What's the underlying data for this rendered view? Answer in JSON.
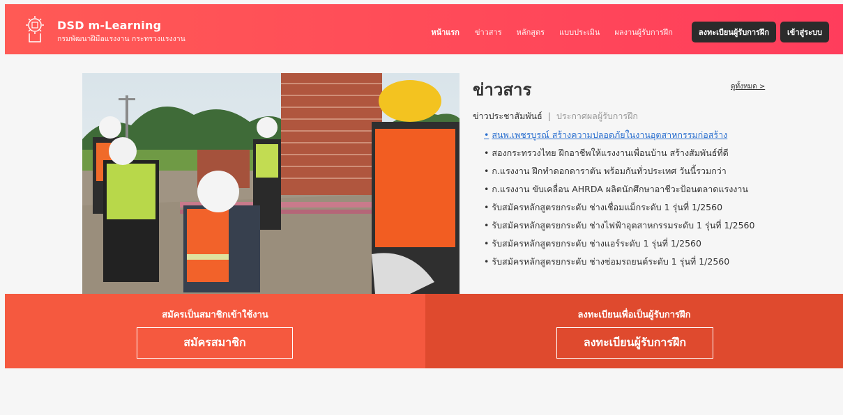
{
  "header": {
    "brand_title": "DSD m-Learning",
    "brand_subtitle": "กรมพัฒนาฝีมือแรงงาน กระทรวงแรงงาน",
    "nav": [
      {
        "label": "หน้าแรก",
        "active": true
      },
      {
        "label": "ข่าวสาร",
        "active": false
      },
      {
        "label": "หลักสูตร",
        "active": false
      },
      {
        "label": "แบบประเมิน",
        "active": false
      },
      {
        "label": "ผลงานผู้รับการฝึก",
        "active": false
      }
    ],
    "register_trainee_button": "ลงทะเบียนผู้รับการฝึก",
    "login_button": "เข้าสู่ระบบ"
  },
  "news": {
    "title": "ข่าวสาร",
    "see_all": "ดูทั้งหมด >",
    "tab_active": "ข่าวประชาสัมพันธ์",
    "tab_separator": "|",
    "tab_inactive": "ประกาศผลผู้รับการฝึก",
    "items": [
      "สนพ.เพชรบูรณ์ สร้างความปลอดภัยในงานอุตสาหกรรมก่อสร้าง",
      "สองกระทรวงไทย ฝึกอาชีพให้แรงงานเพื่อนบ้าน สร้างสัมพันธ์ที่ดี",
      "ก.แรงงาน ฝึกทำดอกดาราตัน พร้อมกันทั่วประเทศ วันนี้รวมกว่า",
      "ก.แรงงาน ขับเคลื่อน AHRDA ผลิตนักศึกษาอาชีวะป้อนตลาดแรงงาน",
      "รับสมัครหลักสูตรยกระดับ ช่างเชื่อมแม็กระดับ 1 รุ่นที่ 1/2560",
      "รับสมัครหลักสูตรยกระดับ ช่างไฟฟ้าอุตสาหกรรมระดับ 1 รุ่นที่ 1/2560",
      "รับสมัครหลักสูตรยกระดับ ช่างแอร์ระดับ 1 รุ่นที่ 1/2560",
      "รับสมัครหลักสูตรยกระดับ ช่างซ่อมรถยนต์ระดับ 1 รุ่นที่ 1/2560"
    ]
  },
  "cta": {
    "left_label": "สมัครเป็นสมาชิกเข้าใช้งาน",
    "left_button": "สมัครสมาชิก",
    "right_label": "ลงทะเบียนเพื่อเป็นผู้รับการฝึก",
    "right_button": "ลงทะเบียนผู้รับการฝึก"
  },
  "colors": {
    "header_start": "#ff5a55",
    "header_end": "#ff3d5c",
    "cta_left": "#f5593f",
    "cta_right": "#df4a2e",
    "link_blue": "#2a6fcf"
  }
}
